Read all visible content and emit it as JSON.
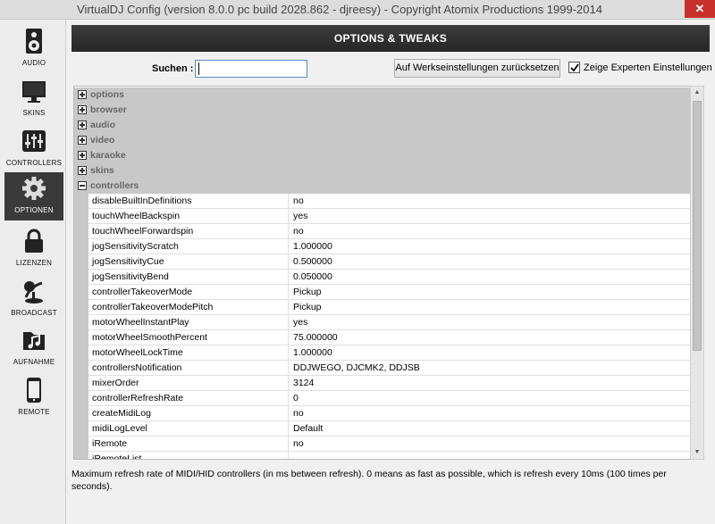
{
  "window": {
    "title": "VirtualDJ Config (version 8.0.0 pc build 2028.862 - djreesy) - Copyright Atomix Productions 1999-2014",
    "close_glyph": "✕"
  },
  "sidebar": {
    "items": [
      {
        "label": "AUDIO",
        "icon": "speaker-icon"
      },
      {
        "label": "SKINS",
        "icon": "monitor-icon"
      },
      {
        "label": "CONTROLLERS",
        "icon": "mixer-sliders-icon"
      },
      {
        "label": "OPTIONEN",
        "icon": "gear-icon"
      },
      {
        "label": "LIZENZEN",
        "icon": "lock-icon"
      },
      {
        "label": "BROADCAST",
        "icon": "broadcast-icon"
      },
      {
        "label": "AUFNAHME",
        "icon": "music-folder-icon"
      },
      {
        "label": "REMOTE",
        "icon": "phone-icon"
      }
    ],
    "active_index": 3
  },
  "header": {
    "title": "OPTIONS & TWEAKS"
  },
  "search": {
    "label": "Suchen :",
    "value": ""
  },
  "reset_button": {
    "label": "Auf Werkseinstellungen zurücksetzen"
  },
  "expert": {
    "label": "Zeige Experten Einstellungen",
    "checked": true
  },
  "groups": [
    {
      "name": "options",
      "expanded": false
    },
    {
      "name": "browser",
      "expanded": false
    },
    {
      "name": "audio",
      "expanded": false
    },
    {
      "name": "video",
      "expanded": false
    },
    {
      "name": "karaoke",
      "expanded": false
    },
    {
      "name": "skins",
      "expanded": false
    },
    {
      "name": "controllers",
      "expanded": true
    }
  ],
  "properties": [
    {
      "name": "disableBuiltInDefinitions",
      "value": "no"
    },
    {
      "name": "touchWheelBackspin",
      "value": "yes"
    },
    {
      "name": "touchWheelForwardspin",
      "value": "no"
    },
    {
      "name": "jogSensitivityScratch",
      "value": "1.000000"
    },
    {
      "name": "jogSensitivityCue",
      "value": "0.500000"
    },
    {
      "name": "jogSensitivityBend",
      "value": "0.050000"
    },
    {
      "name": "controllerTakeoverMode",
      "value": "Pickup"
    },
    {
      "name": "controllerTakeoverModePitch",
      "value": "Pickup"
    },
    {
      "name": "motorWheelInstantPlay",
      "value": "yes"
    },
    {
      "name": "motorWheelSmoothPercent",
      "value": "75.000000"
    },
    {
      "name": "motorWheelLockTime",
      "value": "1.000000"
    },
    {
      "name": "controllersNotification",
      "value": "DDJWEGO, DJCMK2, DDJSB"
    },
    {
      "name": "mixerOrder",
      "value": "3124"
    },
    {
      "name": "controllerRefreshRate",
      "value": "0"
    },
    {
      "name": "createMidiLog",
      "value": "no"
    },
    {
      "name": "midiLogLevel",
      "value": "Default"
    },
    {
      "name": "iRemote",
      "value": "no"
    },
    {
      "name": "iRemoteList",
      "value": ""
    }
  ],
  "description": "Maximum refresh rate of MIDI/HID controllers (in ms between refresh). 0 means as fast as possible, which is refresh every 10ms (100 times per seconds).",
  "colors": {
    "header_bg": "#2e2e2e",
    "active_nav": "#3a3a3a",
    "group_bg": "#c8c8c8",
    "close_bg": "#c7302b"
  }
}
